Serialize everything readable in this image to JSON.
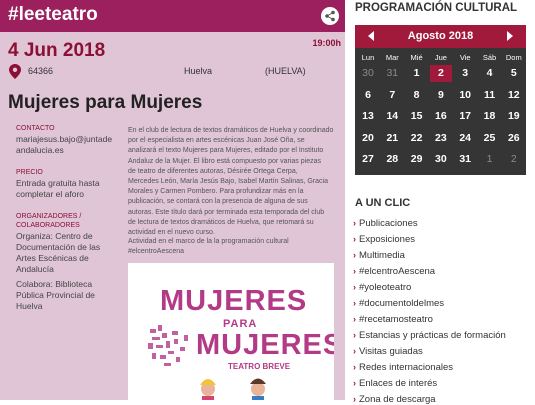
{
  "tag": "#leeteatro",
  "date": "4 Jun 2018",
  "time": "19:00h",
  "location": {
    "postal": "64366",
    "city": "Huelva",
    "province": "(HUELVA)"
  },
  "title": "Mujeres para Mujeres",
  "contacto": {
    "label": "CONTACTO",
    "value": "mariajesus.bajo@juntadeandalucia.es",
    "line1": "mariajesus.bajo@juntade",
    "line2": "andalucia.es"
  },
  "precio": {
    "label": "PRECIO",
    "line1": "Entrada gratuita hasta",
    "line2": "completar el aforo"
  },
  "organizadores": {
    "label1": "ORGANIZADORES /",
    "label2": "COLABORADORES",
    "lines": [
      "Organiza: Centro de",
      "Documentación de las",
      "Artes Escénicas de",
      "Andalucía"
    ],
    "lines2": [
      "Colabora: Biblioteca",
      "Pública Provincial de",
      "Huelva"
    ]
  },
  "description_lines": [
    "En el club de lectura de textos dramáticos de Huelva y coordinado",
    "por el especialista en artes escénicas Juan José Oña, se",
    "analizará el texto Mujeres para Mujeres, editado por el Instituto",
    "Andaluz de la Mujer. El libro está compuesto por varias piezas",
    "de teatro de diferentes autoras, Désirée Ortega Cerpa,",
    "Mercedes León, María Jesús Bajo, Isabel Martín Salinas, Gracia",
    "Morales y Carmen Pombero. Para profundizar más en la",
    "publicación, se contará con la presencia de alguna de sus",
    "autoras. Este título dará por terminada esta temporada del club",
    "de lectura de textos dramáticos de Huelva, que retomará su",
    "actividad en el nuevo curso."
  ],
  "description2_lines": [
    "Actividad en el marco de la la programación cultural",
    "#elcentroAescena"
  ],
  "poster": {
    "line1": "MUJERES",
    "line2": "PARA",
    "line3": "MUJERES",
    "line4": "TEATRO BREVE"
  },
  "sidebar": {
    "heading": "PROGRAMACIÓN CULTURAL",
    "calendar": {
      "month": "Agosto 2018",
      "weekdays": [
        "Lun",
        "Mar",
        "Mié",
        "Jue",
        "Vie",
        "Sáb",
        "Dom"
      ],
      "weeks": [
        [
          "30",
          "31",
          "1",
          "2",
          "3",
          "4",
          "5"
        ],
        [
          "6",
          "7",
          "8",
          "9",
          "10",
          "11",
          "12"
        ],
        [
          "13",
          "14",
          "15",
          "16",
          "17",
          "18",
          "19"
        ],
        [
          "20",
          "21",
          "22",
          "23",
          "24",
          "25",
          "26"
        ],
        [
          "27",
          "28",
          "29",
          "30",
          "31",
          "1",
          "2"
        ]
      ]
    },
    "clic_heading": "A UN CLIC",
    "links": [
      "Publicaciones",
      "Exposiciones",
      "Multimedia",
      "#elcentroAescena",
      "#yoleoteatro",
      "#documentoldelmes",
      "#recetamosteatro",
      "Estancias y prácticas de formación",
      "Visitas guiadas",
      "Redes internacionales",
      "Enlaces de interés",
      "Zona de descarga"
    ]
  },
  "colors": {
    "brand": "#9c1f5e",
    "accent": "#a11a3c",
    "panel": "#dfc5d6",
    "calendar_bg": "#353535"
  }
}
